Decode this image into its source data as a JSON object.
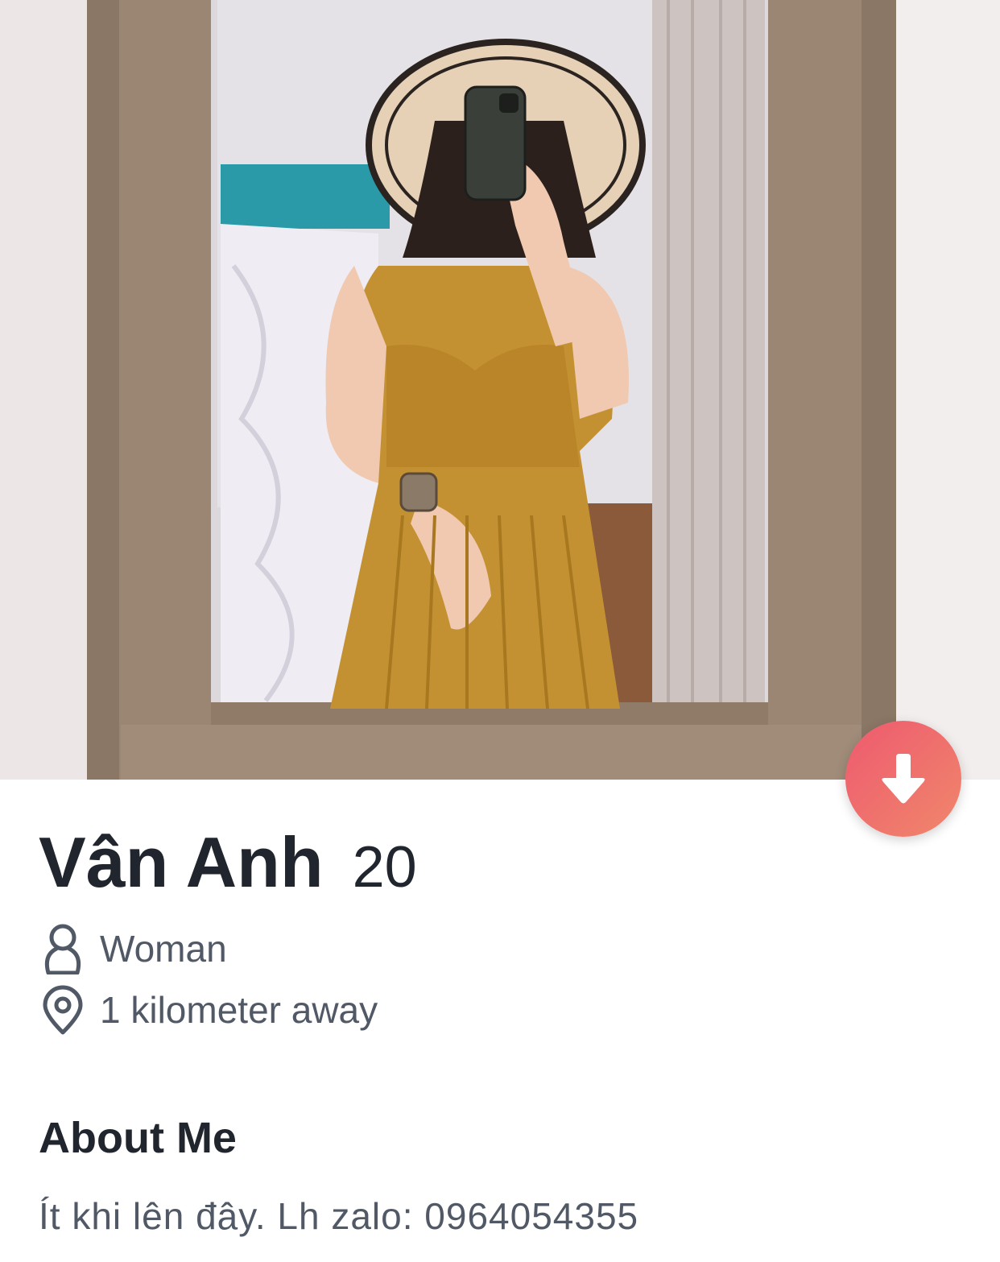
{
  "profile": {
    "name": "Vân Anh",
    "age": "20",
    "gender": "Woman",
    "distance": "1 kilometer away"
  },
  "about": {
    "title": "About Me",
    "text": "Ít khi lên đây. Lh zalo: 0964054355"
  },
  "icons": {
    "collapse": "arrow-down-icon",
    "gender": "person-outline-icon",
    "location": "location-pin-icon"
  },
  "colors": {
    "accent_start": "#ee5a6f",
    "accent_end": "#f0876b",
    "text_primary": "#21262e",
    "text_secondary": "#505965"
  }
}
